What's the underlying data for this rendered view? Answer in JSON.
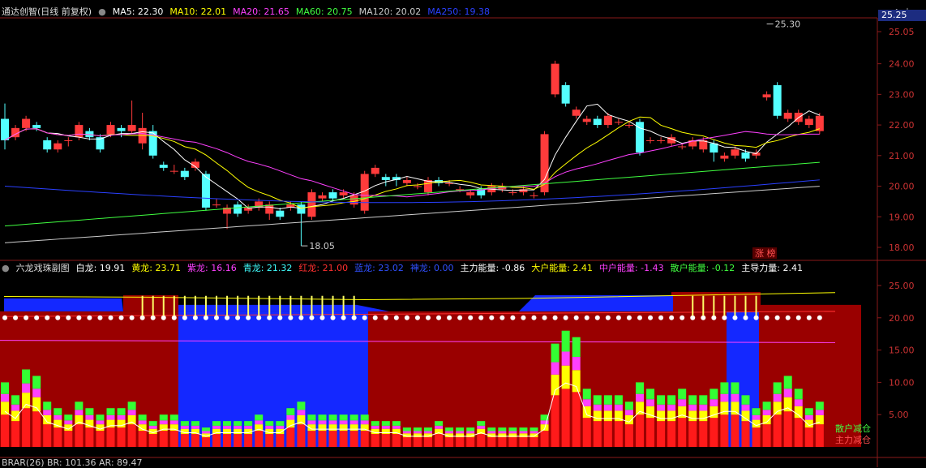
{
  "window": {
    "title": "通达创智(日线 前复权)",
    "corner_price": "25.25"
  },
  "main_panel": {
    "ma_legend": [
      {
        "label": "MA5: 22.30",
        "color": "#ffffff"
      },
      {
        "label": "MA10: 22.01",
        "color": "#ffff00"
      },
      {
        "label": "MA20: 21.65",
        "color": "#ff40ff"
      },
      {
        "label": "MA60: 20.75",
        "color": "#40ff40"
      },
      {
        "label": "MA120: 20.02",
        "color": "#cccccc"
      },
      {
        "label": "MA250: 19.38",
        "color": "#2a40ff"
      }
    ],
    "price_ticks": [
      "25.05",
      "24.00",
      "23.00",
      "22.00",
      "21.00",
      "20.00",
      "19.00",
      "18.00"
    ],
    "high_label": "25.30",
    "low_label": "18.05",
    "limit_up_badge": "涨 榜"
  },
  "sub_panel": {
    "title": "六龙戏珠副图",
    "legend": [
      {
        "label": "白龙: 19.91",
        "color": "#ffffff"
      },
      {
        "label": "黄龙: 23.71",
        "color": "#ffff00"
      },
      {
        "label": "紫龙: 16.16",
        "color": "#ff40ff"
      },
      {
        "label": "青龙: 21.32",
        "color": "#40ffff"
      },
      {
        "label": "红龙: 21.00",
        "color": "#ff3030"
      },
      {
        "label": "蓝龙: 23.02",
        "color": "#3050ff"
      },
      {
        "label": "神龙: 0.00",
        "color": "#3050ff"
      },
      {
        "label": "主力能量: -0.86",
        "color": "#ffffff"
      },
      {
        "label": "大户能量: 2.41",
        "color": "#ffff00"
      },
      {
        "label": "中户能量: -1.43",
        "color": "#ff40ff"
      },
      {
        "label": "散户能量: -0.12",
        "color": "#40ff40"
      },
      {
        "label": "主导力量: 2.41",
        "color": "#ffffff"
      }
    ],
    "ticks": [
      "25.00",
      "20.00",
      "15.00",
      "10.00",
      "5.00"
    ],
    "right_labels": [
      "散户减仓",
      "主力减仓"
    ]
  },
  "bottom_panel": {
    "legend": "BRAR(26) BR: 101.36 AR: 89.47"
  },
  "chart_data": {
    "type": "candlestick",
    "candles": [
      [
        22.2,
        21.5,
        22.7,
        21.2
      ],
      [
        21.6,
        21.9,
        22.0,
        21.5
      ],
      [
        21.9,
        22.2,
        22.3,
        21.8
      ],
      [
        22.0,
        21.9,
        22.1,
        21.8
      ],
      [
        21.5,
        21.2,
        21.6,
        21.1
      ],
      [
        21.2,
        21.4,
        21.5,
        21.1
      ],
      [
        21.5,
        21.5,
        21.6,
        21.3
      ],
      [
        21.6,
        22.0,
        22.1,
        21.5
      ],
      [
        21.8,
        21.6,
        21.9,
        21.5
      ],
      [
        21.6,
        21.2,
        21.7,
        21.1
      ],
      [
        21.7,
        22.0,
        22.1,
        21.6
      ],
      [
        21.9,
        21.8,
        22.0,
        21.6
      ],
      [
        21.8,
        22.0,
        22.8,
        21.7
      ],
      [
        21.4,
        21.9,
        22.4,
        21.2
      ],
      [
        21.8,
        21.0,
        22.0,
        20.9
      ],
      [
        20.7,
        20.6,
        20.8,
        20.5
      ],
      [
        20.5,
        20.5,
        20.7,
        20.4
      ],
      [
        20.5,
        20.3,
        20.6,
        20.2
      ],
      [
        20.6,
        20.8,
        20.9,
        20.5
      ],
      [
        20.4,
        19.3,
        20.5,
        19.2
      ],
      [
        19.4,
        19.4,
        19.6,
        19.3
      ],
      [
        19.1,
        19.3,
        19.4,
        18.6
      ],
      [
        19.4,
        19.1,
        19.5,
        19.0
      ],
      [
        19.2,
        19.3,
        19.4,
        19.1
      ],
      [
        19.3,
        19.5,
        19.6,
        19.2
      ],
      [
        19.1,
        19.4,
        19.5,
        18.9
      ],
      [
        19.2,
        19.0,
        19.3,
        18.9
      ],
      [
        19.3,
        19.4,
        19.5,
        19.2
      ],
      [
        19.4,
        19.1,
        19.5,
        18.05
      ],
      [
        19.0,
        19.8,
        19.9,
        18.9
      ],
      [
        19.6,
        19.7,
        19.8,
        19.5
      ],
      [
        19.8,
        19.6,
        19.9,
        19.5
      ],
      [
        19.7,
        19.8,
        19.9,
        19.6
      ],
      [
        19.4,
        19.7,
        19.8,
        19.3
      ],
      [
        19.2,
        20.4,
        20.5,
        19.1
      ],
      [
        20.4,
        20.6,
        20.7,
        20.3
      ],
      [
        20.3,
        20.2,
        20.4,
        20.0
      ],
      [
        20.3,
        20.2,
        20.4,
        20.0
      ],
      [
        20.1,
        20.2,
        20.3,
        20.0
      ],
      [
        20.0,
        20.0,
        20.1,
        19.9
      ],
      [
        19.8,
        20.2,
        20.3,
        19.7
      ],
      [
        20.2,
        20.1,
        20.3,
        20.0
      ],
      [
        20.1,
        20.1,
        20.2,
        20.0
      ],
      [
        19.9,
        19.9,
        20.0,
        19.8
      ],
      [
        19.7,
        19.8,
        19.9,
        19.6
      ],
      [
        19.9,
        19.7,
        20.0,
        19.6
      ],
      [
        19.8,
        20.0,
        20.1,
        19.7
      ],
      [
        19.9,
        20.0,
        20.1,
        19.8
      ],
      [
        19.8,
        19.8,
        19.9,
        19.7
      ],
      [
        19.8,
        19.9,
        20.0,
        19.7
      ],
      [
        19.7,
        19.7,
        19.8,
        19.6
      ],
      [
        19.8,
        21.7,
        21.8,
        19.7
      ],
      [
        23.0,
        24.0,
        24.1,
        22.9
      ],
      [
        23.3,
        22.7,
        23.4,
        22.6
      ],
      [
        22.3,
        22.5,
        22.6,
        22.2
      ],
      [
        22.1,
        22.2,
        22.3,
        22.0
      ],
      [
        22.2,
        22.0,
        22.3,
        21.9
      ],
      [
        22.0,
        22.3,
        22.4,
        21.9
      ],
      [
        22.1,
        22.1,
        22.2,
        22.0
      ],
      [
        22.0,
        22.0,
        22.1,
        21.9
      ],
      [
        22.1,
        21.1,
        22.2,
        21.0
      ],
      [
        21.5,
        21.5,
        21.6,
        21.4
      ],
      [
        21.5,
        21.5,
        21.6,
        21.4
      ],
      [
        21.4,
        21.6,
        21.7,
        21.3
      ],
      [
        21.3,
        21.3,
        21.4,
        21.2
      ],
      [
        21.3,
        21.5,
        21.6,
        21.2
      ],
      [
        21.2,
        21.5,
        21.6,
        21.1
      ],
      [
        21.4,
        21.1,
        21.5,
        20.8
      ],
      [
        20.9,
        21.0,
        21.1,
        20.8
      ],
      [
        21.0,
        21.2,
        21.3,
        20.9
      ],
      [
        21.1,
        20.9,
        21.2,
        20.8
      ],
      [
        21.0,
        21.1,
        21.2,
        20.9
      ],
      [
        22.9,
        23.0,
        23.1,
        22.8
      ],
      [
        23.3,
        22.3,
        23.4,
        22.2
      ],
      [
        22.2,
        22.4,
        22.5,
        22.1
      ],
      [
        22.1,
        22.4,
        22.5,
        22.0
      ],
      [
        22.0,
        22.2,
        22.3,
        21.9
      ],
      [
        21.8,
        22.3,
        22.4,
        21.7
      ]
    ]
  }
}
